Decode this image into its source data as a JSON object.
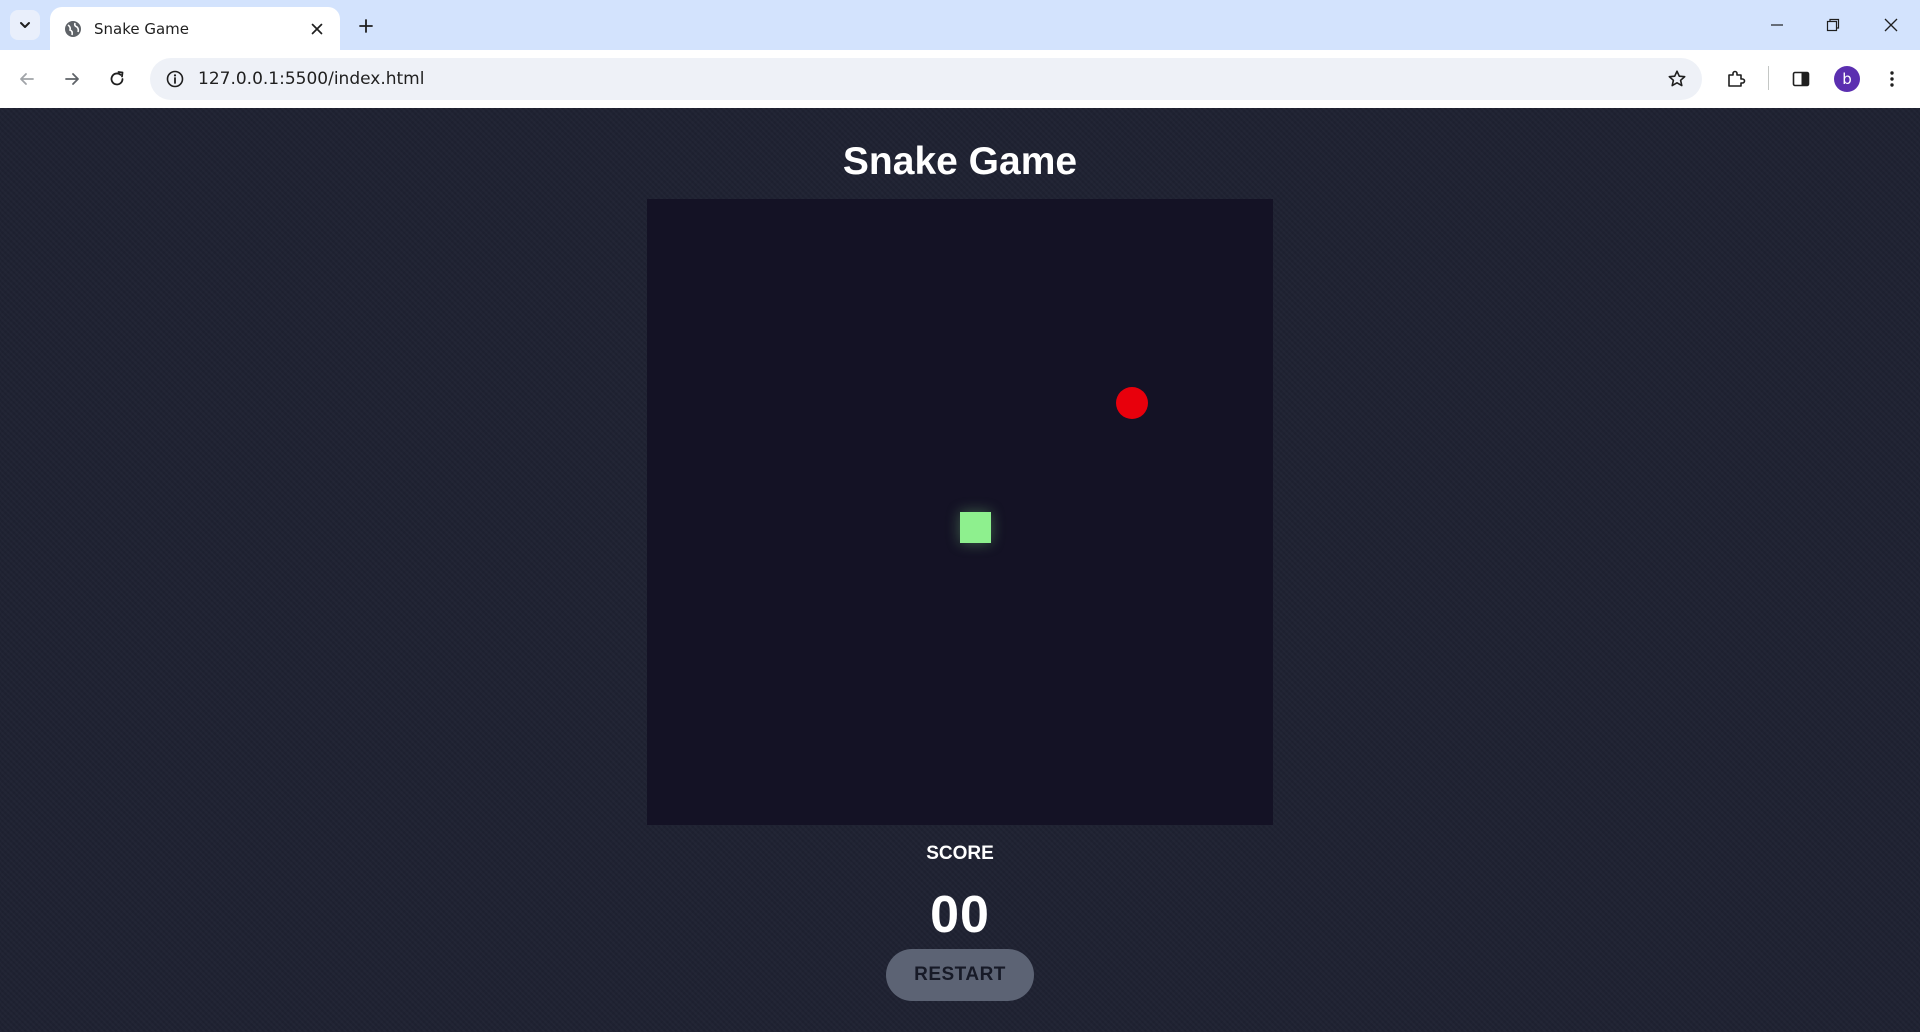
{
  "browser": {
    "tab_title": "Snake Game",
    "url": "127.0.0.1:5500/index.html",
    "profile_initial": "b",
    "colors": {
      "tabstrip": "#d3e3fd",
      "avatar": "#5b2fb0"
    }
  },
  "game": {
    "title": "Snake Game",
    "score_label": "SCORE",
    "score_value": "00",
    "restart_label": "RESTART",
    "colors": {
      "page_background": "#1f2232",
      "board_background": "#141225",
      "snake": "#8ef08e",
      "food": "#e8000c",
      "restart_button": "#5c6374"
    }
  }
}
